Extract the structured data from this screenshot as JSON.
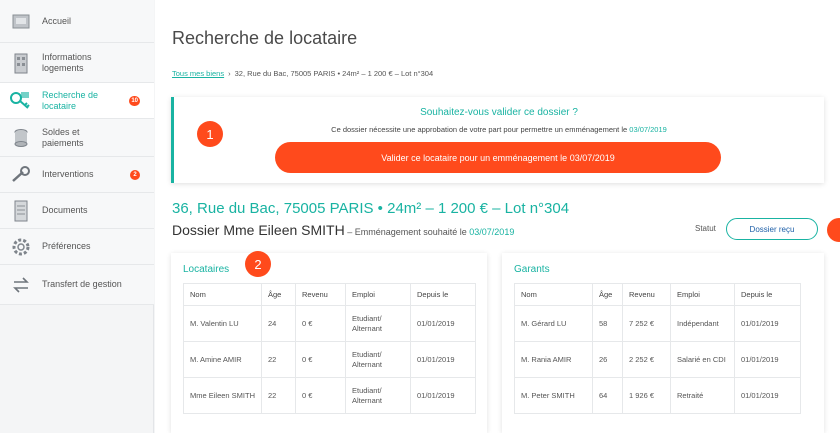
{
  "sidebar": {
    "items": [
      {
        "label": "Accueil",
        "icon": "home-icon",
        "badge": ""
      },
      {
        "label": "Informations logements",
        "icon": "building-icon",
        "badge": ""
      },
      {
        "label": "Recherche de locataire",
        "icon": "key-icon",
        "badge": "10"
      },
      {
        "label": "Soldes et paiements",
        "icon": "coins-icon",
        "badge": ""
      },
      {
        "label": "Interventions",
        "icon": "wrench-icon",
        "badge": "2"
      },
      {
        "label": "Documents",
        "icon": "document-icon",
        "badge": ""
      },
      {
        "label": "Préférences",
        "icon": "gear-icon",
        "badge": ""
      },
      {
        "label": "Transfert de gestion",
        "icon": "transfer-icon",
        "badge": ""
      }
    ]
  },
  "page": {
    "title": "Recherche de locataire",
    "breadcrumb_link": "Tous mes biens",
    "breadcrumb_text": "32, Rue du Bac, 75005 PARIS • 24m² – 1 200 € – Lot n°304"
  },
  "alert": {
    "title": "Souhaitez-vous valider ce dossier ?",
    "text": "Ce dossier nécessite une approbation de votre part pour permettre un emménagement le",
    "date": "03/07/2019",
    "button": "Valider ce locataire pour un emménagement le 03/07/2019"
  },
  "markers": {
    "one": "1",
    "two": "2"
  },
  "property": {
    "address": "36, Rue du Bac, 75005 PARIS • 24m² – 1 200 € – Lot n°304",
    "dossier": "Dossier Mme Eileen SMITH",
    "move_text": " – Emménagement souhaité le ",
    "move_date": "03/07/2019",
    "status_label": "Statut",
    "status_value": "Dossier reçu"
  },
  "tenants": {
    "title": "Locataires",
    "columns": [
      "Nom",
      "Âge",
      "Revenu",
      "Emploi",
      "Depuis le"
    ],
    "rows": [
      [
        "M. Valentin LU",
        "24",
        "0 €",
        "Etudiant/ Alternant",
        "01/01/2019"
      ],
      [
        "M. Amine AMIR",
        "22",
        "0 €",
        "Etudiant/ Alternant",
        "01/01/2019"
      ],
      [
        "Mme Eileen SMITH",
        "22",
        "0 €",
        "Etudiant/ Alternant",
        "01/01/2019"
      ]
    ]
  },
  "guarantors": {
    "title": "Garants",
    "columns": [
      "Nom",
      "Âge",
      "Revenu",
      "Emploi",
      "Depuis le"
    ],
    "rows": [
      [
        "M. Gérard LU",
        "58",
        "7 252 €",
        "Indépendant",
        "01/01/2019"
      ],
      [
        "M. Rania AMIR",
        "26",
        "2 252 €",
        "Salarié en CDI",
        "01/01/2019"
      ],
      [
        "M. Peter SMITH",
        "64",
        "1 926 €",
        "Retraité",
        "01/01/2019"
      ]
    ]
  },
  "colors": {
    "accent": "#19b3a2",
    "alert": "#ff4a1c",
    "link": "#1d5fa8"
  }
}
